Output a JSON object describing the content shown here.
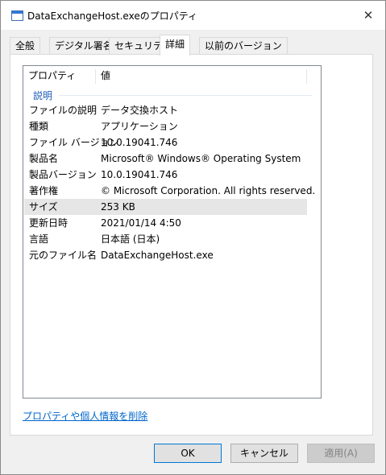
{
  "window": {
    "title": "DataExchangeHost.exeのプロパティ",
    "close_glyph": "✕"
  },
  "tabs": [
    {
      "label": "全般"
    },
    {
      "label": "デジタル署名"
    },
    {
      "label": "セキュリティ"
    },
    {
      "label": "詳細"
    },
    {
      "label": "以前のバージョン"
    }
  ],
  "active_tab": "詳細",
  "list": {
    "columns": {
      "name": "プロパティ",
      "value": "値"
    },
    "group": "説明",
    "rows": [
      {
        "name": "ファイルの説明",
        "value": "データ交換ホスト"
      },
      {
        "name": "種類",
        "value": "アプリケーション"
      },
      {
        "name": "ファイル バージョン",
        "value": "10.0.19041.746"
      },
      {
        "name": "製品名",
        "value": "Microsoft® Windows® Operating System"
      },
      {
        "name": "製品バージョン",
        "value": "10.0.19041.746"
      },
      {
        "name": "著作権",
        "value": "© Microsoft Corporation. All rights reserved."
      },
      {
        "name": "サイズ",
        "value": "253 KB"
      },
      {
        "name": "更新日時",
        "value": "2021/01/14 4:50"
      },
      {
        "name": "言語",
        "value": "日本語 (日本)"
      },
      {
        "name": "元のファイル名",
        "value": "DataExchangeHost.exe"
      }
    ],
    "selected_row": "サイズ"
  },
  "remove_link": "プロパティや個人情報を削除",
  "buttons": {
    "ok": "OK",
    "cancel": "キャンセル",
    "apply": "適用(A)"
  }
}
